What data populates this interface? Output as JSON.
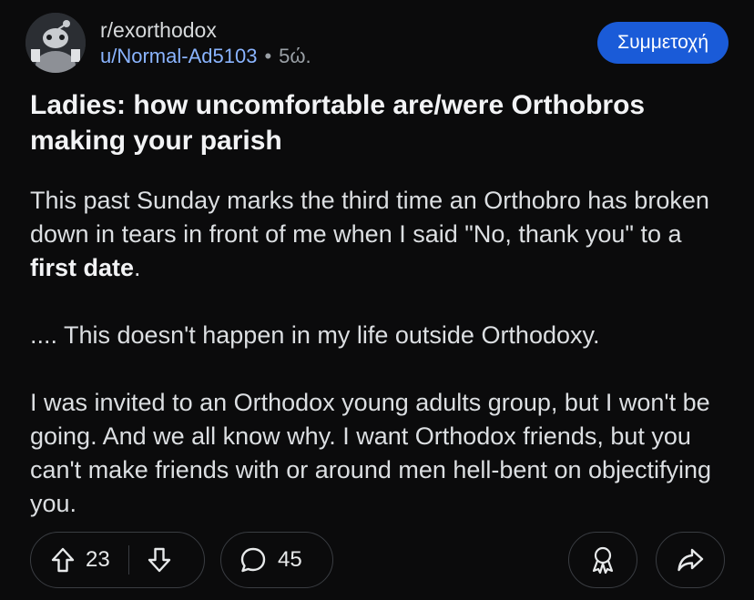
{
  "post": {
    "subreddit": "r/exorthodox",
    "user": "u/Normal-Ad5103",
    "separator": "•",
    "age": "5ώ.",
    "join_label": "Συμμετοχή",
    "title": "Ladies: how uncomfortable are/were Orthobros making your parish",
    "body": {
      "p1_before": "This past Sunday marks the third time an Orthobro has broken down in tears in front of me when I said \"No, thank you\" to a ",
      "p1_bold": "first date",
      "p1_after": ".",
      "p2": ".... This doesn't happen in my life outside Orthodoxy.",
      "p3": "I was invited to an Orthodox young adults group, but I won't be going. And we all know why. I want Orthodox friends, but you can't make friends with or around men hell-bent on objectifying you."
    }
  },
  "actions": {
    "upvotes": "23",
    "comments": "45"
  },
  "icons": {
    "upvote": "upvote-arrow-icon",
    "downvote": "downvote-arrow-icon",
    "comment": "comment-bubble-icon",
    "award": "award-icon",
    "share": "share-arrow-icon"
  }
}
